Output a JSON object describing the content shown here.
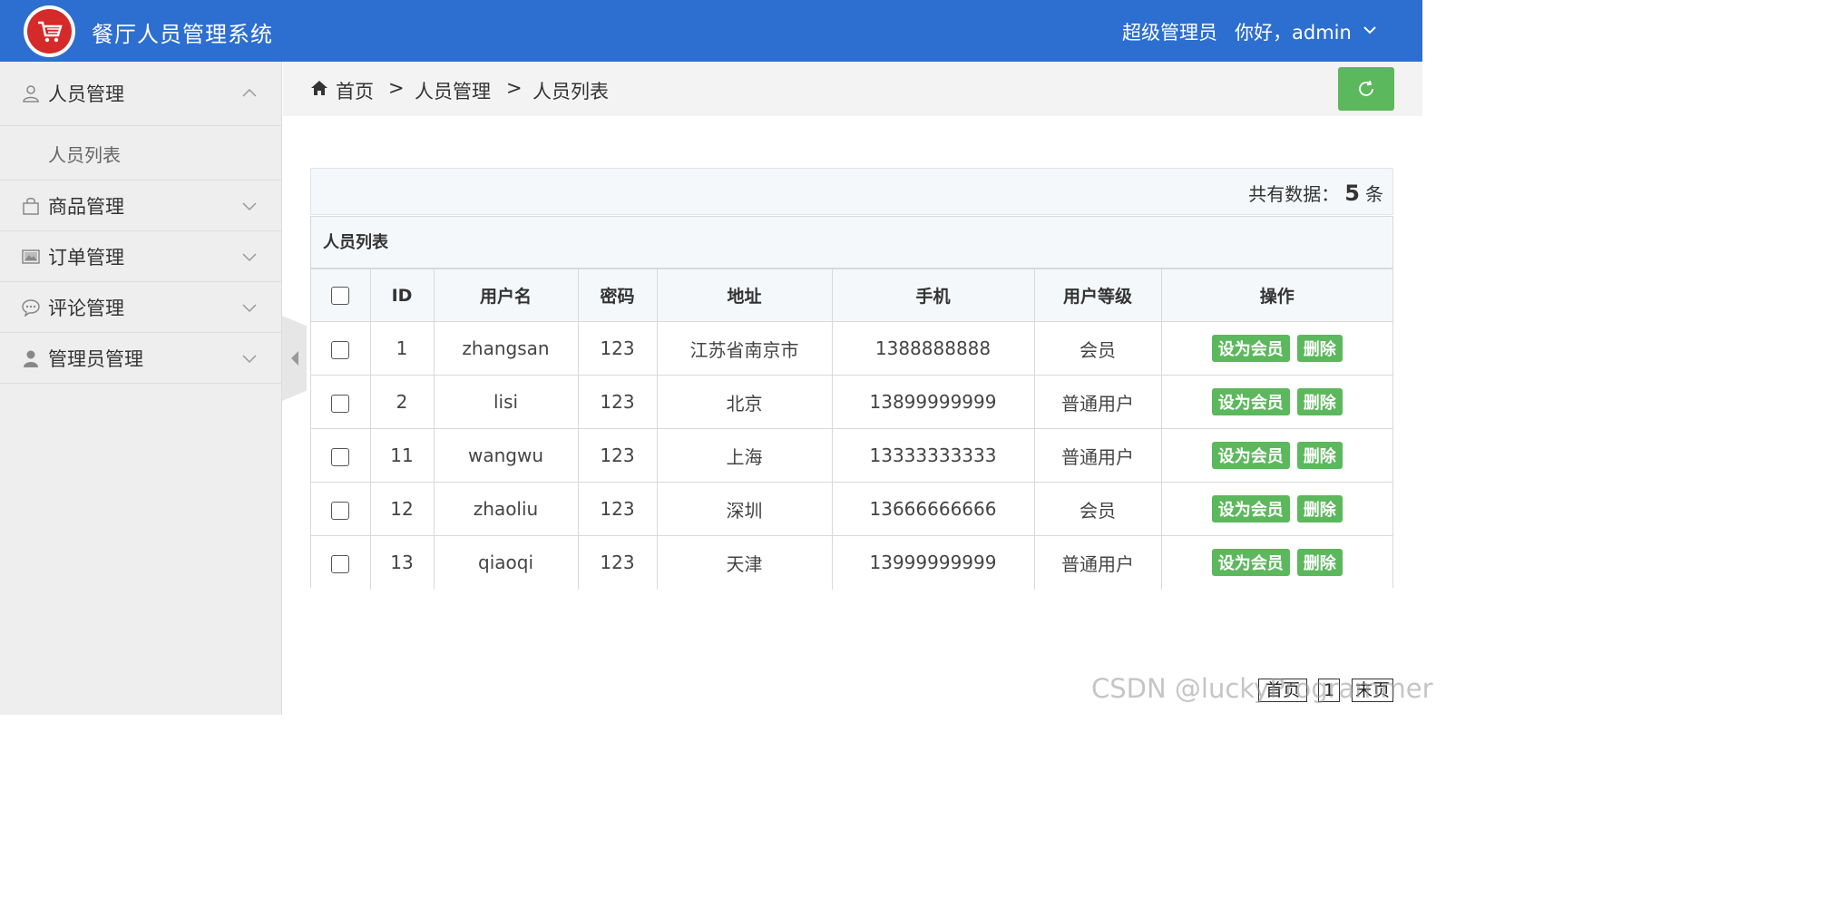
{
  "header": {
    "title": "餐厅人员管理系统",
    "role": "超级管理员",
    "greeting": "你好，admin"
  },
  "sidebar": {
    "items": [
      {
        "label": "人员管理",
        "icon": "user-icon",
        "expanded": true
      },
      {
        "label": "商品管理",
        "icon": "bag-icon",
        "expanded": false
      },
      {
        "label": "订单管理",
        "icon": "image-icon",
        "expanded": false
      },
      {
        "label": "评论管理",
        "icon": "chat-icon",
        "expanded": false
      },
      {
        "label": "管理员管理",
        "icon": "person-icon",
        "expanded": false
      }
    ],
    "submenu": {
      "label": "人员列表"
    }
  },
  "breadcrumb": {
    "home": "首页",
    "sep": ">",
    "level1": "人员管理",
    "level2": "人员列表"
  },
  "summary": {
    "prefix": "共有数据：",
    "count": "5",
    "suffix": "条"
  },
  "table": {
    "title": "人员列表",
    "headers": [
      "ID",
      "用户名",
      "密码",
      "地址",
      "手机",
      "用户等级",
      "操作"
    ],
    "rows": [
      {
        "id": "1",
        "username": "zhangsan",
        "password": "123",
        "address": "江苏省南京市",
        "phone": "1388888888",
        "level": "会员"
      },
      {
        "id": "2",
        "username": "lisi",
        "password": "123",
        "address": "北京",
        "phone": "13899999999",
        "level": "普通用户"
      },
      {
        "id": "11",
        "username": "wangwu",
        "password": "123",
        "address": "上海",
        "phone": "13333333333",
        "level": "普通用户"
      },
      {
        "id": "12",
        "username": "zhaoliu",
        "password": "123",
        "address": "深圳",
        "phone": "13666666666",
        "level": "会员"
      },
      {
        "id": "13",
        "username": "qiaoqi",
        "password": "123",
        "address": "天津",
        "phone": "13999999999",
        "level": "普通用户"
      }
    ],
    "actions": {
      "set_member": "设为会员",
      "delete": "删除"
    }
  },
  "pagination": {
    "first": "首页",
    "current": "1",
    "last": "末页"
  },
  "watermark": "CSDN @luckyProgrammer",
  "colors": {
    "header": "#2d6fd0",
    "accent_green": "#5cb85c",
    "logo_red": "#d42a2a"
  }
}
